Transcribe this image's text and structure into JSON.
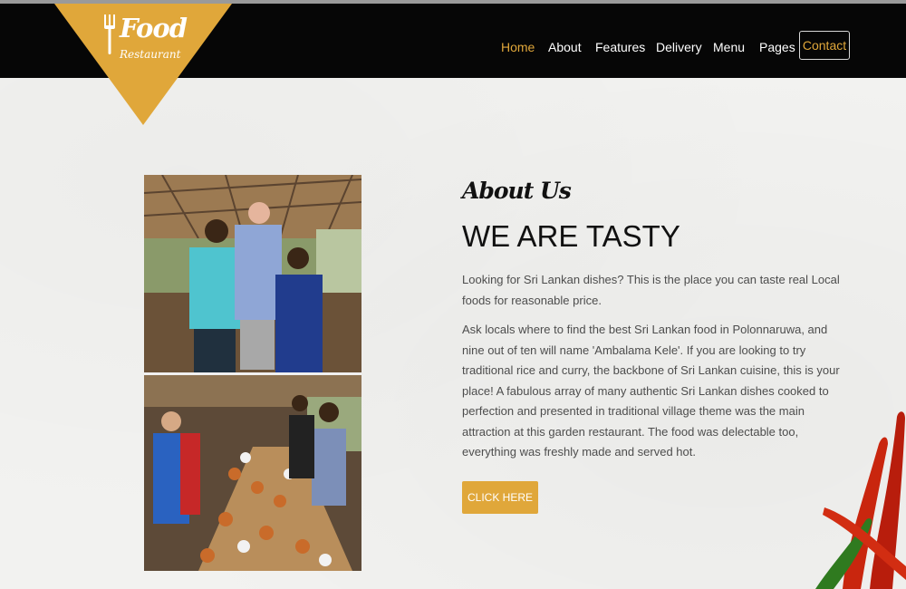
{
  "logo": {
    "line1": "Food",
    "line2": "Restaurant"
  },
  "nav": {
    "items": [
      {
        "label": "Home",
        "active": true
      },
      {
        "label": "About",
        "active": false
      },
      {
        "label": "Features",
        "active": false
      },
      {
        "label": "Delivery",
        "active": false
      },
      {
        "label": "Menu",
        "active": false
      },
      {
        "label": "Pages",
        "active": false
      }
    ],
    "contact": "Contact"
  },
  "about": {
    "script_title": "About Us",
    "headline": "WE ARE TASTY",
    "paragraph_1": "Looking for Sri Lankan dishes? This is the place you can taste real Local foods for reasonable price.",
    "paragraph_2": "Ask locals where to find the best Sri Lankan food in Polonnaruwa, and nine out of ten will name 'Ambalama Kele'. If you are looking to try traditional rice and curry, the backbone of Sri Lankan cuisine, this is your place! A fabulous array of many authentic Sri Lankan dishes cooked to perfection and presented in traditional village theme was the main attraction at this garden restaurant. The food was delectable too, everything was freshly made and served hot.",
    "button": "CLICK HERE"
  },
  "colors": {
    "accent": "#e0a73a",
    "navbar": "#060606",
    "background": "#f2f2f0"
  }
}
